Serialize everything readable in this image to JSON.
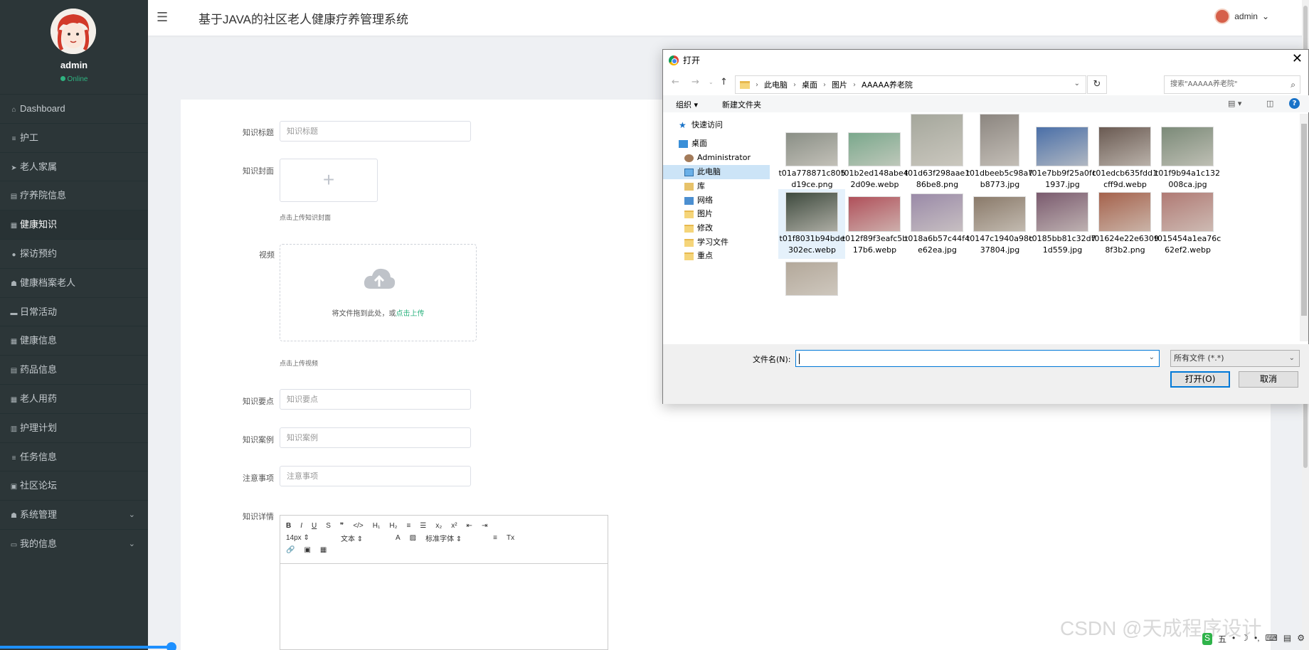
{
  "sidebar": {
    "user": "admin",
    "status": "Online",
    "items": [
      {
        "label": "Dashboard",
        "icon": "home-icon"
      },
      {
        "label": "护工",
        "icon": "list-icon"
      },
      {
        "label": "老人家属",
        "icon": "send-icon"
      },
      {
        "label": "疗养院信息",
        "icon": "doc-icon"
      },
      {
        "label": "健康知识",
        "icon": "grid-icon",
        "active": true
      },
      {
        "label": "探访预约",
        "icon": "pin-icon"
      },
      {
        "label": "健康档案老人",
        "icon": "user-icon"
      },
      {
        "label": "日常活动",
        "icon": "chat-icon"
      },
      {
        "label": "健康信息",
        "icon": "grid-icon"
      },
      {
        "label": "药品信息",
        "icon": "doc-icon"
      },
      {
        "label": "老人用药",
        "icon": "grid-icon"
      },
      {
        "label": "护理计划",
        "icon": "chart-icon"
      },
      {
        "label": "任务信息",
        "icon": "list-icon"
      },
      {
        "label": "社区论坛",
        "icon": "building-icon"
      },
      {
        "label": "系统管理",
        "icon": "user-icon",
        "expandable": true
      },
      {
        "label": "我的信息",
        "icon": "card-icon",
        "expandable": true
      }
    ]
  },
  "header": {
    "title": "基于JAVA的社区老人健康疗养管理系统",
    "user": "admin",
    "chevron": "⌄"
  },
  "form": {
    "title_label": "知识标题",
    "title_placeholder": "知识标题",
    "cover_label": "知识封面",
    "cover_hint": "点击上传知识封面",
    "video_label": "视频",
    "video_drop_text": "将文件拖到此处，或",
    "video_drop_link": "点击上传",
    "video_hint": "点击上传视频",
    "points_label": "知识要点",
    "points_placeholder": "知识要点",
    "cases_label": "知识案例",
    "cases_placeholder": "知识案例",
    "notes_label": "注意事项",
    "notes_placeholder": "注意事项",
    "detail_label": "知识详情"
  },
  "editor": {
    "row1": [
      "B",
      "I",
      "U",
      "S",
      "❞",
      "</>",
      "H₁",
      "H₂",
      "≡",
      "☰",
      "x₂",
      "x²",
      "⇤",
      "⇥"
    ],
    "size": "14px",
    "format": "文本",
    "font": "标准字体",
    "row2_icons": [
      "A",
      "▨",
      "≡",
      "Tx"
    ],
    "row3": [
      "🔗",
      "▣",
      "▦"
    ]
  },
  "dialog": {
    "title": "打开",
    "path": [
      "此电脑",
      "桌面",
      "图片",
      "AAAAA养老院"
    ],
    "search_placeholder": "搜索\"AAAAA养老院\"",
    "organize": "组织 ▾",
    "new_folder": "新建文件夹",
    "help": "?",
    "tree": [
      {
        "label": "快速访问",
        "icon": "star",
        "indent": 22
      },
      {
        "label": "桌面",
        "icon": "desk",
        "indent": 22
      },
      {
        "label": "Administrator",
        "icon": "admin",
        "indent": 30
      },
      {
        "label": "此电脑",
        "icon": "pc",
        "indent": 30,
        "selected": true
      },
      {
        "label": "库",
        "icon": "lib",
        "indent": 30
      },
      {
        "label": "网络",
        "icon": "net",
        "indent": 30
      },
      {
        "label": "图片",
        "icon": "fold",
        "indent": 30
      },
      {
        "label": "修改",
        "icon": "fold",
        "indent": 30
      },
      {
        "label": "学习文件",
        "icon": "fold",
        "indent": 30
      },
      {
        "label": "重点",
        "icon": "fold",
        "indent": 30
      }
    ],
    "files": [
      {
        "name": "t01a778871c805d19ce.png",
        "color": "#8a8f86"
      },
      {
        "name": "t01b2ed148abe42d09e.webp",
        "color": "#7aa88c"
      },
      {
        "name": "t01d63f298aae186be8.png",
        "color": "#a5a79c"
      },
      {
        "name": "t01dbeeb5c98a7b8773.jpg",
        "color": "#8c8680"
      },
      {
        "name": "t01e7bb9f25a0fc1937.jpg",
        "color": "#4a6fa8"
      },
      {
        "name": "t01edcb635fdd1cff9d.webp",
        "color": "#6a5a52"
      },
      {
        "name": "t01f9b94a1c132008ca.jpg",
        "color": "#7b8a78"
      },
      {
        "name": "t01f8031b94bde302ec.webp",
        "color": "#3e4a3e",
        "selected": true
      },
      {
        "name": "t012f89f3eafc5b17b6.webp",
        "color": "#b0505a"
      },
      {
        "name": "t018a6b57c44f4e62ea.jpg",
        "color": "#9a8aa8"
      },
      {
        "name": "t0147c1940a98c37804.jpg",
        "color": "#8a7a6a"
      },
      {
        "name": "t0185bb81c32d71d559.jpg",
        "color": "#7a5a6e"
      },
      {
        "name": "t01624e22e63098f3b2.png",
        "color": "#a5624c"
      },
      {
        "name": "t015454a1ea76c62ef2.webp",
        "color": "#b07a74"
      },
      {
        "name": "",
        "color": "#b3a89a"
      }
    ],
    "filename_label": "文件名(N):",
    "filename_value": "",
    "filter": "所有文件 (*.*)",
    "open_button": "打开(O)",
    "cancel_button": "取消"
  },
  "watermark": "CSDN @天成程序设计",
  "tray": [
    "S",
    "五",
    "•",
    "☽",
    "•,",
    "⌨",
    "▤",
    "⚙"
  ]
}
